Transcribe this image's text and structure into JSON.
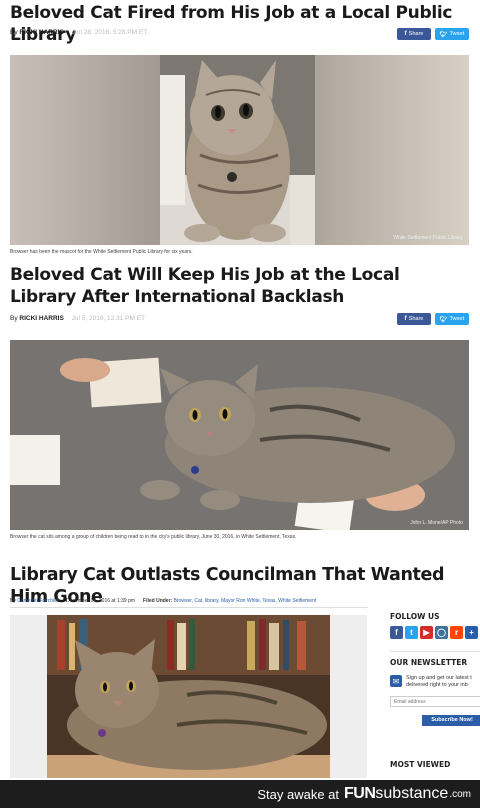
{
  "article1": {
    "headline": "Beloved Cat Fired from His Job at a Local Public Library",
    "by": "By",
    "author": "RICKI HARRIS",
    "date": "Jun 28, 2016, 5:28 PM ET",
    "share_label": "Share",
    "tweet_label": "Tweet",
    "caption": "Browser has been the mascot for the White Settlement Public Library for six years.",
    "credit": "White Settlement Public Library"
  },
  "article2": {
    "headline": "Beloved Cat Will Keep His Job at the Local Library After International Backlash",
    "by": "By",
    "author": "RICKI HARRIS",
    "date": "Jul 5, 2016, 12:31 PM ET",
    "share_label": "Share",
    "tweet_label": "Tweet",
    "caption": "Browser the cat sits among a group of children being read to in the city's public library, June 30, 2016, in White Settlement, Texas.",
    "credit": "John L. Mone/AP Photo"
  },
  "article3": {
    "headline": "Library Cat Outlasts Councilman That Wanted Him Gone",
    "by": "By",
    "author": "Cameron Fairchild",
    "date": "December 14, 2016 at 1:39 pm",
    "filed_label": "Filed Under:",
    "tags": "Browser, Cat, library, Mayor Ron White, Texas, White Settlement"
  },
  "sidebar": {
    "follow_title": "FOLLOW US",
    "newsletter_title": "OUR NEWSLETTER",
    "newsletter_text_line1": "Sign up and get our latest t",
    "newsletter_text_line2": "delivered right to your inb",
    "email_placeholder": "Email address",
    "subscribe_label": "Subscribe Now!",
    "most_viewed_title": "MOST VIEWED"
  },
  "footer": {
    "tagline": "Stay awake at",
    "logo_fun": "FUN",
    "logo_substance": "substance",
    "logo_domain": ".com"
  },
  "colors": {
    "facebook": "#3b5998",
    "twitter": "#2aa3ef",
    "link_blue": "#2b5ea7",
    "footer_bg": "#1d1d1d"
  }
}
